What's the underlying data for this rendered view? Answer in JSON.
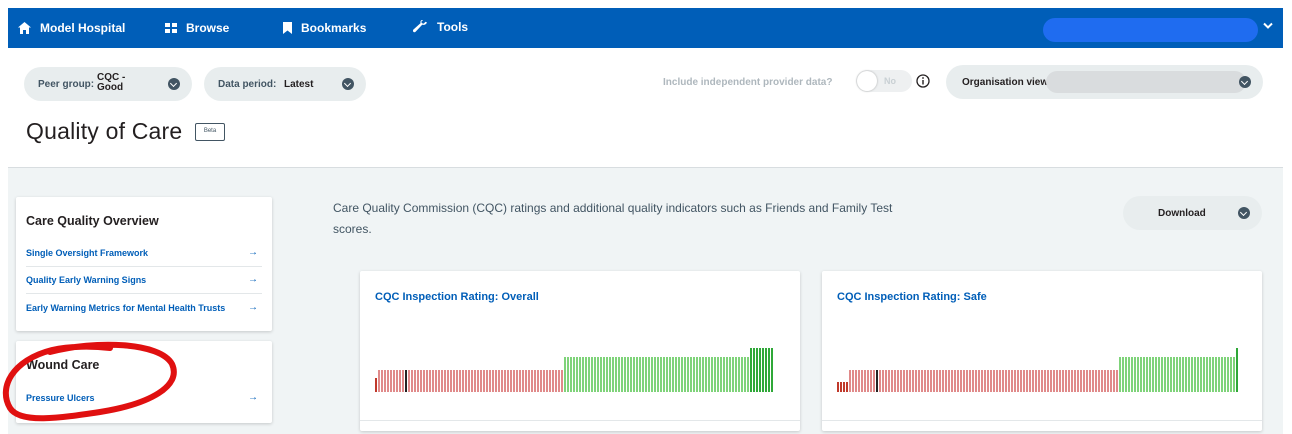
{
  "nav": {
    "home": "Model Hospital",
    "browse": "Browse",
    "bookmarks": "Bookmarks",
    "tools": "Tools"
  },
  "filters": {
    "peer_group_label": "Peer group:",
    "peer_group_value_line1": "CQC -",
    "peer_group_value_line2": "Good",
    "data_period_label": "Data period:",
    "data_period_value": "Latest",
    "independent_label": "Include independent provider data?",
    "toggle_state": "No",
    "organisation_label": "Organisation view"
  },
  "page": {
    "title": "Quality of Care",
    "badge": "Beta",
    "description": "Care Quality Commission (CQC) ratings and additional quality indicators such as Friends and Family Test scores.",
    "download_label": "Download"
  },
  "sidebar": {
    "overview_title": "Care Quality Overview",
    "overview_links": [
      {
        "label": "Single Oversight Framework",
        "arrow": "→"
      },
      {
        "label": "Quality Early Warning Signs",
        "arrow": "→"
      },
      {
        "label": "Early Warning Metrics for Mental Health Trusts",
        "arrow": "→"
      }
    ],
    "wound_title": "Wound Care",
    "wound_links": [
      {
        "label": "Pressure Ulcers",
        "arrow": "→"
      }
    ]
  },
  "charts": [
    {
      "title": "CQC Inspection Rating: Overall"
    },
    {
      "title": "CQC Inspection Rating: Safe"
    }
  ],
  "colors": {
    "nav_blue": "#005eb8",
    "link_blue": "#005eb8",
    "bar_red": "#e08a8a",
    "bar_green": "#7fd37a",
    "bar_dark_green": "#2fa838",
    "bar_dark_red": "#c0392b",
    "annotation_red": "#e01010"
  }
}
